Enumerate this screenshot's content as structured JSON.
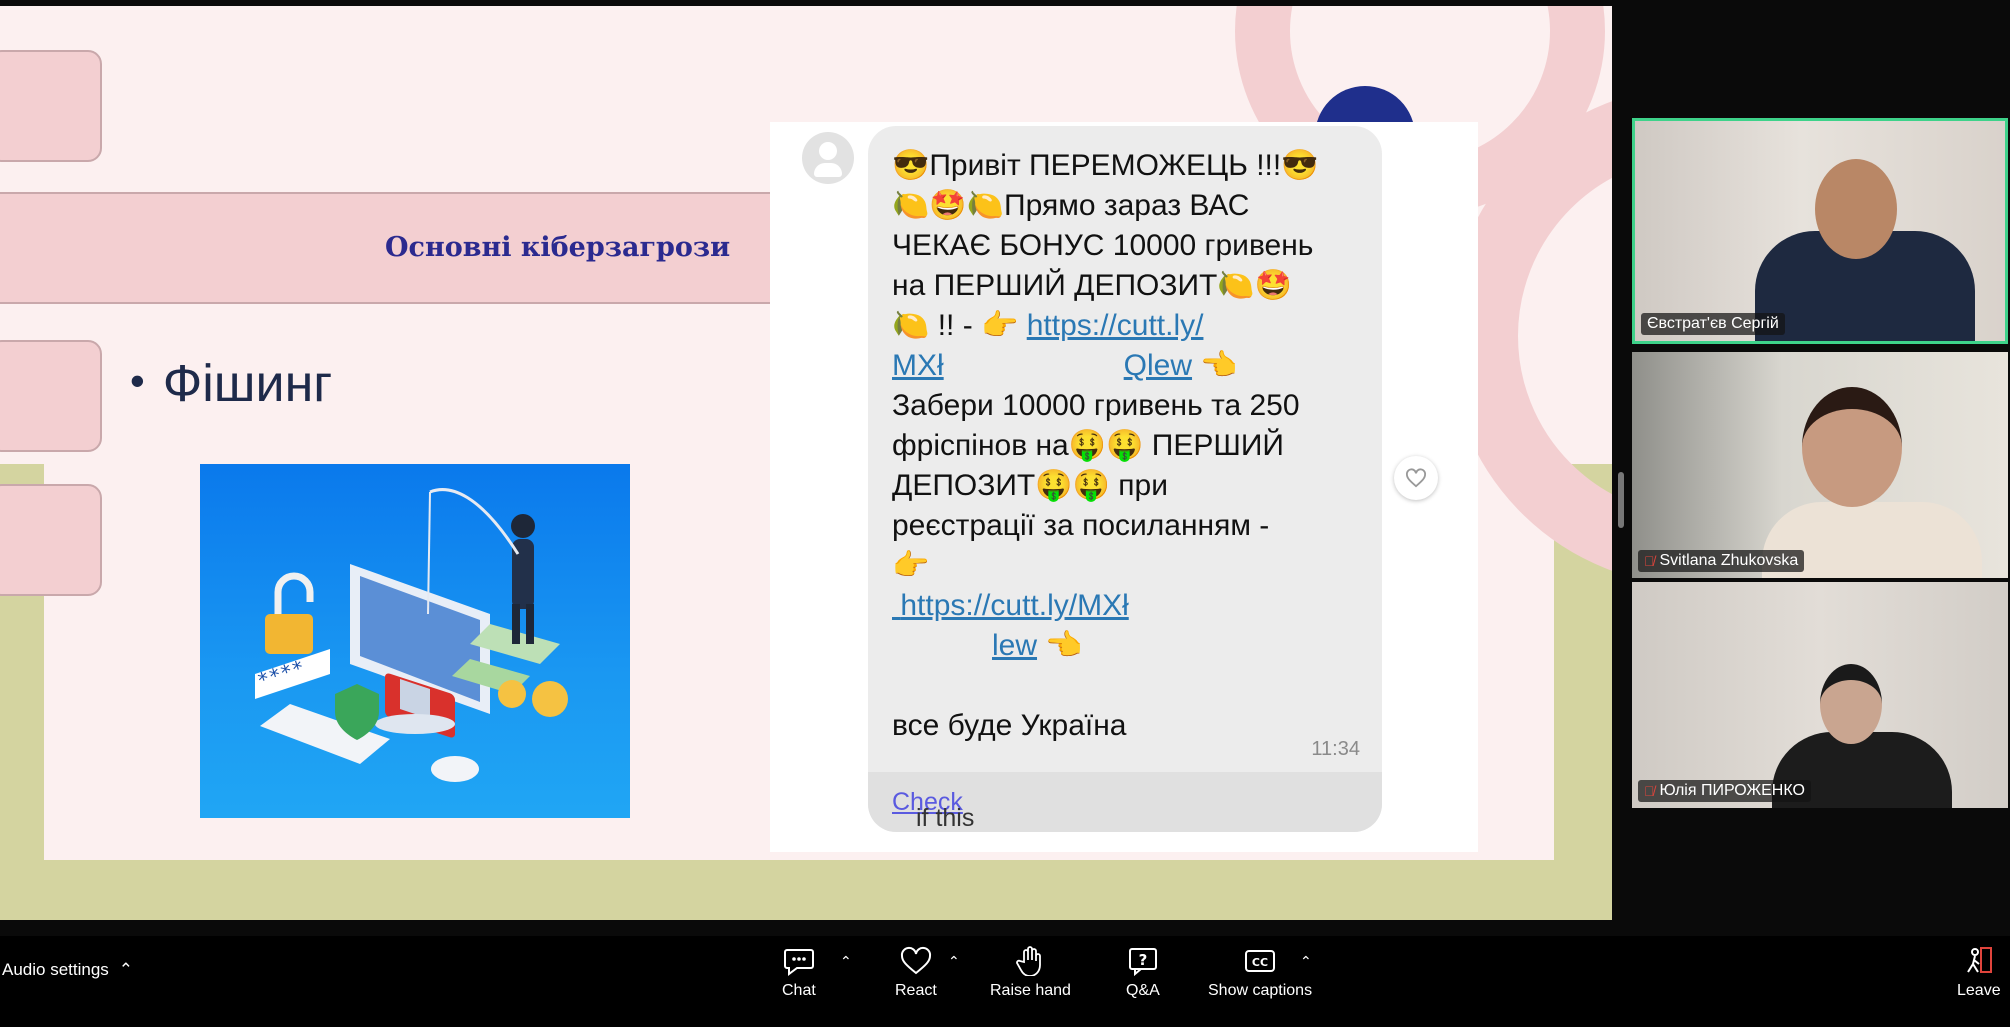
{
  "slide": {
    "title": "Основні кіберзагрози",
    "bullet": "Фішинг",
    "message": {
      "line1": "😎Привіт ПЕРЕМОЖЕЦЬ !!!😎",
      "line2": "🍋🤩🍋Прямо зараз ВАС",
      "line3": "ЧЕКАЄ БОНУС 10000 гривень",
      "line4": "на ПЕРШИЙ ДЕПОЗИТ🍋🤩",
      "line5_pre": "🍋 !! - 👉 ",
      "link1a": "https://cutt.ly/",
      "link1b_start": "MXł",
      "link1b_end": "Qlew",
      "line6_post": " 👈",
      "line7": "Забери 10000 гривень та 250",
      "line8": "фріспінов на🤑🤑 ПЕРШИЙ",
      "line9": "ДЕПОЗИТ🤑🤑 при",
      "line10": "реєстрації за посиланням -",
      "line11": "👉",
      "link2a": " https://cutt.ly/MXł",
      "link2b": "lew",
      "line12_post": " 👈",
      "line13": "все буде Україна",
      "time": "11:34",
      "footer_link": "Check",
      "footer_text": " if this message contains spam"
    }
  },
  "participants": [
    {
      "name": "Євстрат'єв Сергій",
      "muted": false,
      "active": true
    },
    {
      "name": "Svitlana Zhukovska",
      "muted": true,
      "active": false
    },
    {
      "name": "Юлія ПИРОЖЕНКО",
      "muted": true,
      "active": false
    }
  ],
  "toolbar": {
    "audio_settings": "Audio settings",
    "chat": "Chat",
    "react": "React",
    "raise_hand": "Raise hand",
    "qa": "Q&A",
    "show_captions": "Show captions",
    "leave": "Leave"
  },
  "colors": {
    "slide_bg": "#fcf0f0",
    "pink": "#f3cfd1",
    "olive": "#d4d4a0",
    "title_blue": "#2b2a8f",
    "active_speaker": "#3ed28a",
    "leave_red": "#e0443c"
  }
}
